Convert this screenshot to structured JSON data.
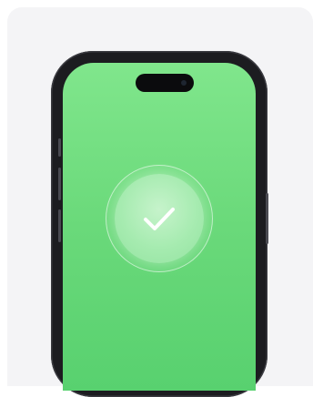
{
  "icons": {
    "status": "check-icon"
  },
  "colors": {
    "card_background": "#f4f4f6",
    "screen_top": "#80e68c",
    "screen_bottom": "#58d16f",
    "frame": "#1c1c20",
    "check": "#ffffff"
  }
}
